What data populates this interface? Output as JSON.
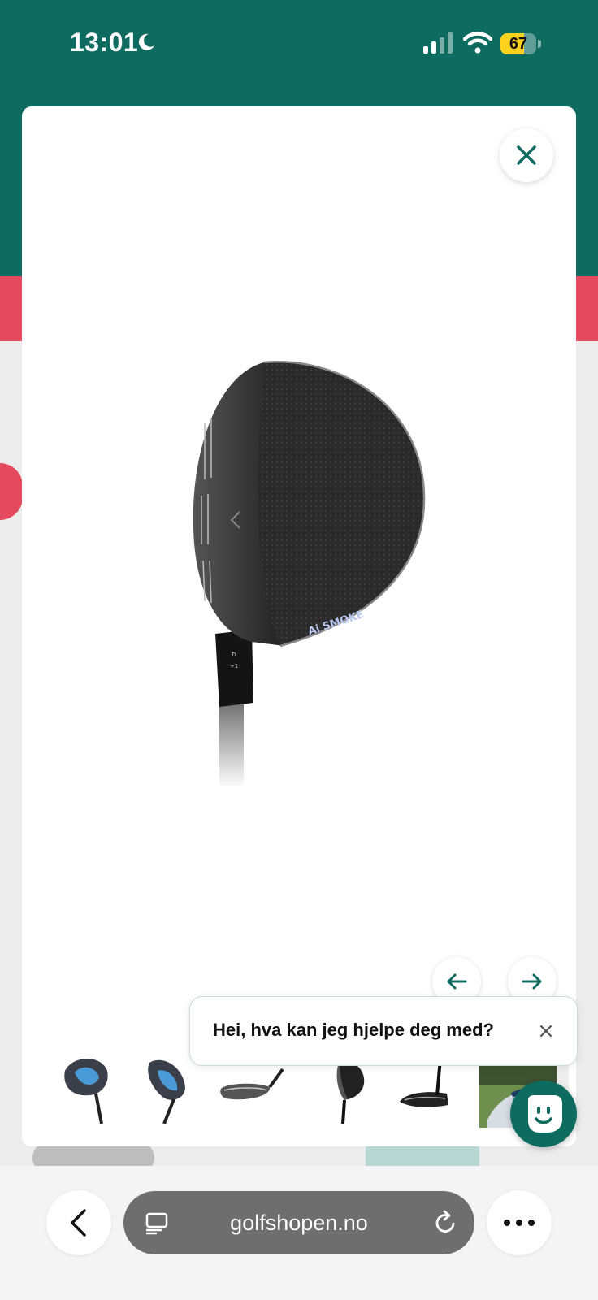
{
  "status_bar": {
    "time": "13:01",
    "battery_percent": "67",
    "battery_level": 0.67,
    "icons": [
      "moon-icon",
      "cellular-signal-icon",
      "wifi-icon",
      "battery-icon"
    ]
  },
  "gallery": {
    "close_icon": "close-icon",
    "prev_icon": "arrow-left-icon",
    "next_icon": "arrow-right-icon",
    "product_logo_text": "Ai SMOKE",
    "thumbnails": [
      "thumbnail-1",
      "thumbnail-2",
      "thumbnail-3",
      "thumbnail-4",
      "thumbnail-5",
      "thumbnail-6"
    ]
  },
  "chat": {
    "greeting": "Hei, hva kan jeg hjelpe deg med?",
    "close_icon": "close-icon",
    "launcher_icon": "chat-face-icon"
  },
  "browser": {
    "url": "golfshopen.no",
    "back_icon": "chevron-left-icon",
    "tabs_icon": "tabs-icon",
    "reload_icon": "reload-icon",
    "more_icon": "more-dots-icon"
  },
  "colors": {
    "brand_green": "#0e6b60",
    "accent_red": "#e5495e",
    "battery_yellow": "#ffd21f"
  }
}
